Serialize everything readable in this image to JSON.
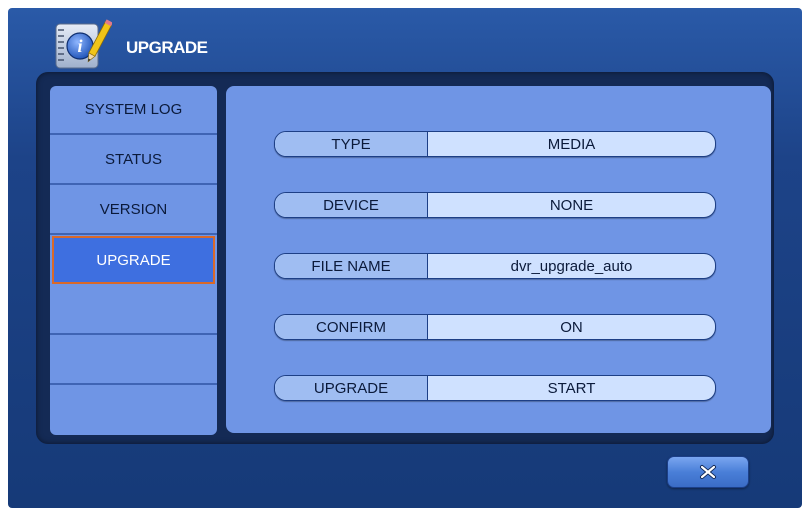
{
  "window": {
    "title": "UPGRADE",
    "title_icon": "info-notebook-pencil-icon"
  },
  "sidebar": {
    "items": [
      {
        "label": "SYSTEM LOG",
        "active": false
      },
      {
        "label": "STATUS",
        "active": false
      },
      {
        "label": "VERSION",
        "active": false
      },
      {
        "label": "UPGRADE",
        "active": true
      },
      {
        "label": "",
        "active": false
      },
      {
        "label": "",
        "active": false
      },
      {
        "label": "",
        "active": false
      }
    ]
  },
  "fields": [
    {
      "label": "TYPE",
      "value": "MEDIA"
    },
    {
      "label": "DEVICE",
      "value": "NONE"
    },
    {
      "label": "FILE NAME",
      "value": "dvr_upgrade_auto"
    },
    {
      "label": "CONFIRM",
      "value": "ON"
    },
    {
      "label": "UPGRADE",
      "value": "START"
    }
  ],
  "footer": {
    "close_icon": "close-x-icon"
  },
  "colors": {
    "window_bg": "#1d4388",
    "panel_bg": "#6f95e5",
    "active_item_bg": "#3e6fe0",
    "active_item_border": "#d9692a",
    "value_bg": "#cfe1ff"
  }
}
